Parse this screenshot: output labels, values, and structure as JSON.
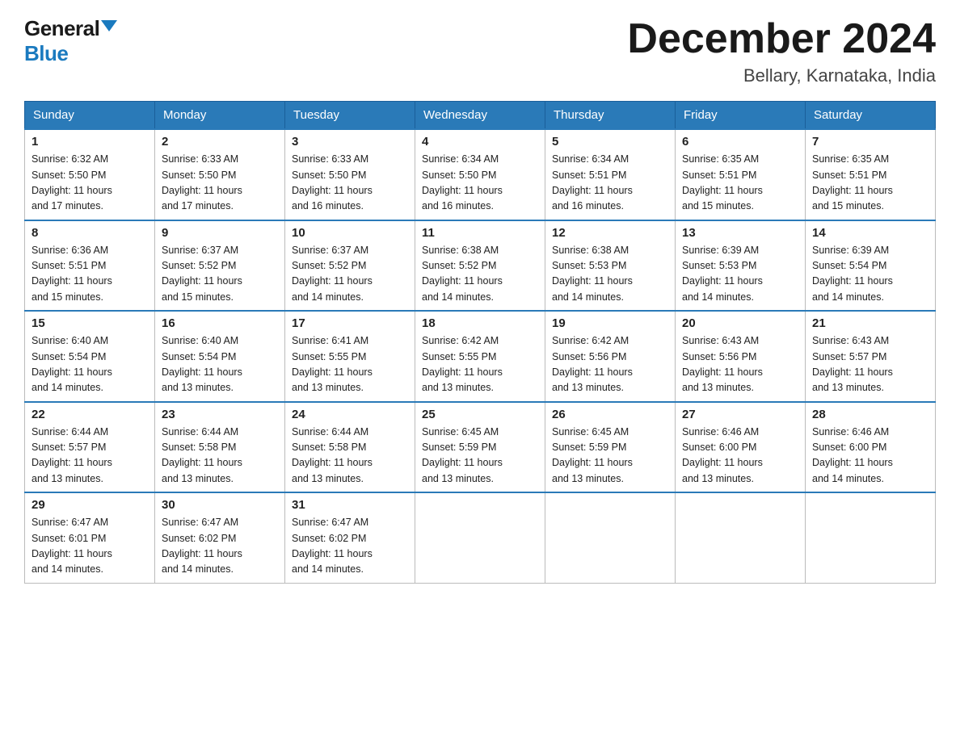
{
  "header": {
    "logo_general": "General",
    "logo_blue": "Blue",
    "title": "December 2024",
    "location": "Bellary, Karnataka, India"
  },
  "days_of_week": [
    "Sunday",
    "Monday",
    "Tuesday",
    "Wednesday",
    "Thursday",
    "Friday",
    "Saturday"
  ],
  "weeks": [
    [
      {
        "day": "1",
        "sunrise": "6:32 AM",
        "sunset": "5:50 PM",
        "daylight": "11 hours and 17 minutes."
      },
      {
        "day": "2",
        "sunrise": "6:33 AM",
        "sunset": "5:50 PM",
        "daylight": "11 hours and 17 minutes."
      },
      {
        "day": "3",
        "sunrise": "6:33 AM",
        "sunset": "5:50 PM",
        "daylight": "11 hours and 16 minutes."
      },
      {
        "day": "4",
        "sunrise": "6:34 AM",
        "sunset": "5:50 PM",
        "daylight": "11 hours and 16 minutes."
      },
      {
        "day": "5",
        "sunrise": "6:34 AM",
        "sunset": "5:51 PM",
        "daylight": "11 hours and 16 minutes."
      },
      {
        "day": "6",
        "sunrise": "6:35 AM",
        "sunset": "5:51 PM",
        "daylight": "11 hours and 15 minutes."
      },
      {
        "day": "7",
        "sunrise": "6:35 AM",
        "sunset": "5:51 PM",
        "daylight": "11 hours and 15 minutes."
      }
    ],
    [
      {
        "day": "8",
        "sunrise": "6:36 AM",
        "sunset": "5:51 PM",
        "daylight": "11 hours and 15 minutes."
      },
      {
        "day": "9",
        "sunrise": "6:37 AM",
        "sunset": "5:52 PM",
        "daylight": "11 hours and 15 minutes."
      },
      {
        "day": "10",
        "sunrise": "6:37 AM",
        "sunset": "5:52 PM",
        "daylight": "11 hours and 14 minutes."
      },
      {
        "day": "11",
        "sunrise": "6:38 AM",
        "sunset": "5:52 PM",
        "daylight": "11 hours and 14 minutes."
      },
      {
        "day": "12",
        "sunrise": "6:38 AM",
        "sunset": "5:53 PM",
        "daylight": "11 hours and 14 minutes."
      },
      {
        "day": "13",
        "sunrise": "6:39 AM",
        "sunset": "5:53 PM",
        "daylight": "11 hours and 14 minutes."
      },
      {
        "day": "14",
        "sunrise": "6:39 AM",
        "sunset": "5:54 PM",
        "daylight": "11 hours and 14 minutes."
      }
    ],
    [
      {
        "day": "15",
        "sunrise": "6:40 AM",
        "sunset": "5:54 PM",
        "daylight": "11 hours and 14 minutes."
      },
      {
        "day": "16",
        "sunrise": "6:40 AM",
        "sunset": "5:54 PM",
        "daylight": "11 hours and 13 minutes."
      },
      {
        "day": "17",
        "sunrise": "6:41 AM",
        "sunset": "5:55 PM",
        "daylight": "11 hours and 13 minutes."
      },
      {
        "day": "18",
        "sunrise": "6:42 AM",
        "sunset": "5:55 PM",
        "daylight": "11 hours and 13 minutes."
      },
      {
        "day": "19",
        "sunrise": "6:42 AM",
        "sunset": "5:56 PM",
        "daylight": "11 hours and 13 minutes."
      },
      {
        "day": "20",
        "sunrise": "6:43 AM",
        "sunset": "5:56 PM",
        "daylight": "11 hours and 13 minutes."
      },
      {
        "day": "21",
        "sunrise": "6:43 AM",
        "sunset": "5:57 PM",
        "daylight": "11 hours and 13 minutes."
      }
    ],
    [
      {
        "day": "22",
        "sunrise": "6:44 AM",
        "sunset": "5:57 PM",
        "daylight": "11 hours and 13 minutes."
      },
      {
        "day": "23",
        "sunrise": "6:44 AM",
        "sunset": "5:58 PM",
        "daylight": "11 hours and 13 minutes."
      },
      {
        "day": "24",
        "sunrise": "6:44 AM",
        "sunset": "5:58 PM",
        "daylight": "11 hours and 13 minutes."
      },
      {
        "day": "25",
        "sunrise": "6:45 AM",
        "sunset": "5:59 PM",
        "daylight": "11 hours and 13 minutes."
      },
      {
        "day": "26",
        "sunrise": "6:45 AM",
        "sunset": "5:59 PM",
        "daylight": "11 hours and 13 minutes."
      },
      {
        "day": "27",
        "sunrise": "6:46 AM",
        "sunset": "6:00 PM",
        "daylight": "11 hours and 13 minutes."
      },
      {
        "day": "28",
        "sunrise": "6:46 AM",
        "sunset": "6:00 PM",
        "daylight": "11 hours and 14 minutes."
      }
    ],
    [
      {
        "day": "29",
        "sunrise": "6:47 AM",
        "sunset": "6:01 PM",
        "daylight": "11 hours and 14 minutes."
      },
      {
        "day": "30",
        "sunrise": "6:47 AM",
        "sunset": "6:02 PM",
        "daylight": "11 hours and 14 minutes."
      },
      {
        "day": "31",
        "sunrise": "6:47 AM",
        "sunset": "6:02 PM",
        "daylight": "11 hours and 14 minutes."
      },
      null,
      null,
      null,
      null
    ]
  ]
}
